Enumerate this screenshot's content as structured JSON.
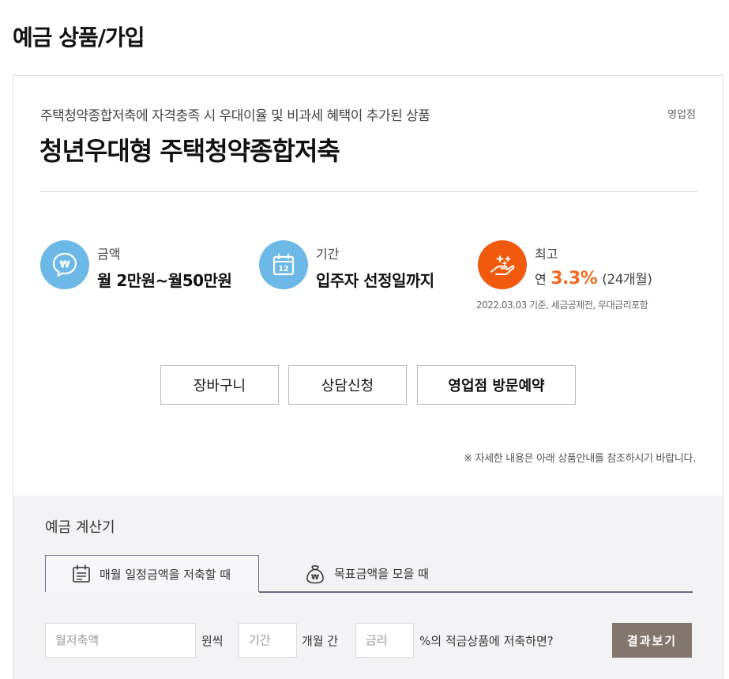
{
  "page": {
    "title": "예금 상품/가입"
  },
  "product": {
    "subtitle": "주택청약종합저축에 자격충족 시 우대이율 및 비과세 혜택이 추가된 상품",
    "branch_tag": "영업점",
    "name": "청년우대형 주택청약종합저축"
  },
  "info": {
    "amount": {
      "label": "금액",
      "value": "월 2만원~월50만원",
      "icon": "won-speech-bubble-icon"
    },
    "period": {
      "label": "기간",
      "value": "입주자 선정일까지",
      "icon": "calendar-12-icon"
    },
    "rate": {
      "label": "최고",
      "prefix": "연",
      "value": "3.3%",
      "suffix": "(24개월)",
      "note": "2022.03.03 기준, 세금공제전, 우대금리포함",
      "icon": "hand-sparkle-icon"
    }
  },
  "actions": {
    "cart": "장바구니",
    "consult": "상담신청",
    "visit": "영업점 방문예약"
  },
  "notice": "※ 자세한 내용은 아래 상품안내를 참조하시기 바랍니다.",
  "calculator": {
    "title": "예금 계산기",
    "tabs": [
      {
        "label": "매월 일정금액을 저축할 때",
        "icon": "calendar-list-icon",
        "active": true
      },
      {
        "label": "목표금액을 모을 때",
        "icon": "money-bag-icon",
        "active": false
      }
    ],
    "monthly_placeholder": "월저축액",
    "unit_won": "원씩",
    "period_placeholder": "기간",
    "unit_months": "개월 간",
    "rate_placeholder": "금리",
    "unit_rate": "%의 적금상품에 저축하면?",
    "submit": "결과보기"
  },
  "colors": {
    "accent_orange": "#f26a21",
    "icon_blue": "#6cb8e6",
    "icon_orange": "#f15a0e",
    "tab_border": "#6a6a86",
    "result_button": "#82776c"
  }
}
